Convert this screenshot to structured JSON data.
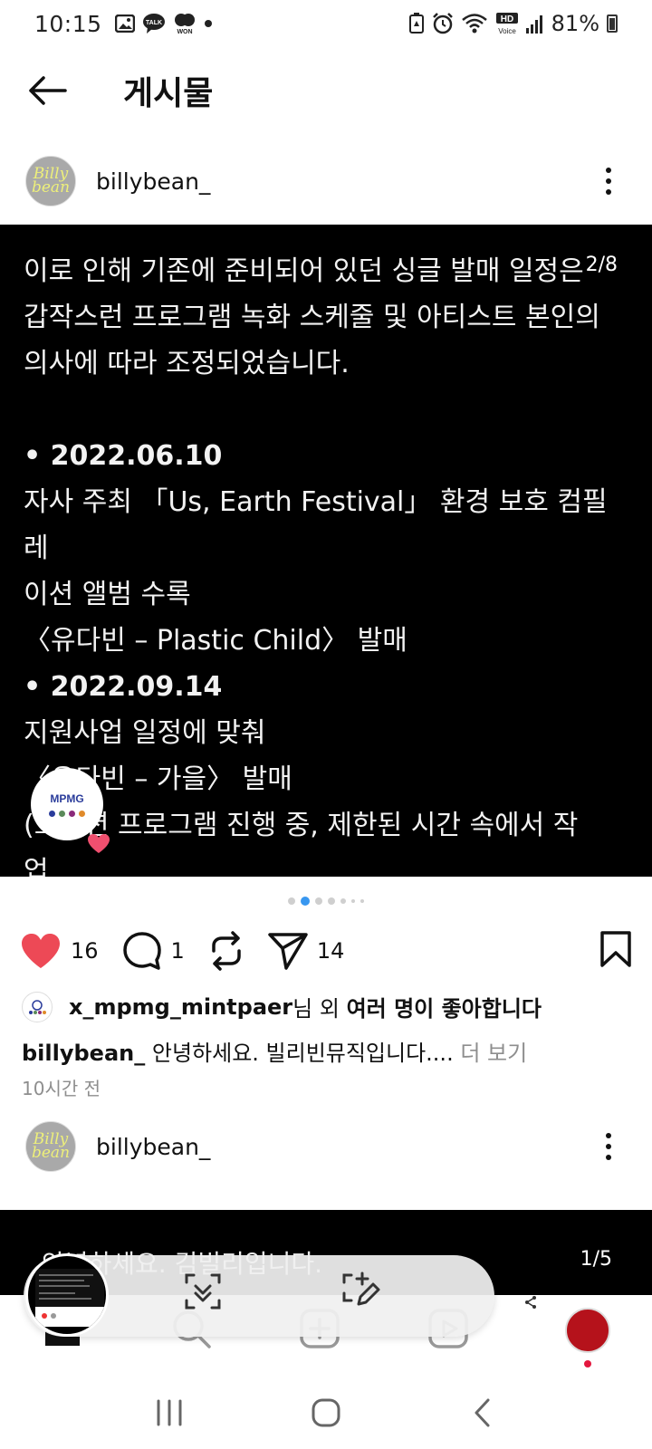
{
  "status_bar": {
    "time": "10:15",
    "notification_icons": [
      "gallery-icon",
      "kakaotalk-icon",
      "won-icon",
      "dot-icon"
    ],
    "right_icons": [
      "battery-saver-icon",
      "alarm-icon",
      "wifi-icon",
      "hd-voice-icon",
      "signal-icon"
    ],
    "hd_voice_label": "HD",
    "voice_label": "Voice",
    "talk_label": "TALK",
    "won_label": "WON",
    "battery_percent": "81%"
  },
  "header": {
    "title": "게시물",
    "back_icon": "arrow-left-icon"
  },
  "post1": {
    "username": "billybean_",
    "avatar_text_1": "Billy",
    "avatar_text_2": "bean",
    "page_counter": "2/8",
    "lines": [
      "이로 인해 기존에 준비되어 있던 싱글 발매 일정은",
      "갑작스런 프로그램 녹화 스케줄 및 아티스트 본인의",
      "의사에 따라 조정되었습니다.",
      "",
      "• 2022.06.10",
      "자사 주최 「Us, Earth Festival」 환경 보호 컴필레",
      "이션 앨범 수록",
      "〈유다빈 – Plastic Child〉 발매",
      "• 2022.09.14",
      "지원사업 일정에 맞춰",
      "〈유다빈 – 가을〉 발매",
      "(오디션 프로그램 진행 중, 제한된 시간 속에서 작",
      "업"
    ],
    "bold_lines": [
      4,
      8
    ],
    "brand_badge_text": "MPMG",
    "carousel_total": 7,
    "carousel_active": 1,
    "likes_count": "16",
    "comments_count": "1",
    "shares_count": "14",
    "liked_by_user": "x_mpmg_mintpaer",
    "liked_by_suffix": "님 외 ",
    "liked_by_others": "여러 명이 좋아합니다",
    "caption_user": "billybean_",
    "caption_text": " 안녕하세요. 빌리빈뮤직입니다.... ",
    "caption_more": "더 보기",
    "time_ago": "10시간 전"
  },
  "post2": {
    "username": "billybean_",
    "avatar_text_1": "Billy",
    "avatar_text_2": "bean",
    "text": "안녕하세요. 김빌리입니다.",
    "page_counter": "1/5"
  },
  "bottom_nav": {
    "items": [
      "home-icon",
      "search-icon",
      "new-post-icon",
      "reels-icon",
      "profile-avatar"
    ]
  },
  "overlay": {
    "buttons": [
      "smart-select-icon",
      "draw-screenshot-icon",
      "share-icon"
    ]
  },
  "system_nav": [
    "recents-button",
    "home-button",
    "back-button"
  ],
  "colors": {
    "like_red": "#ed4956",
    "carousel_active": "#3897f0",
    "muted": "#8e8e8e",
    "brand_blue": "#2a3c9b"
  }
}
